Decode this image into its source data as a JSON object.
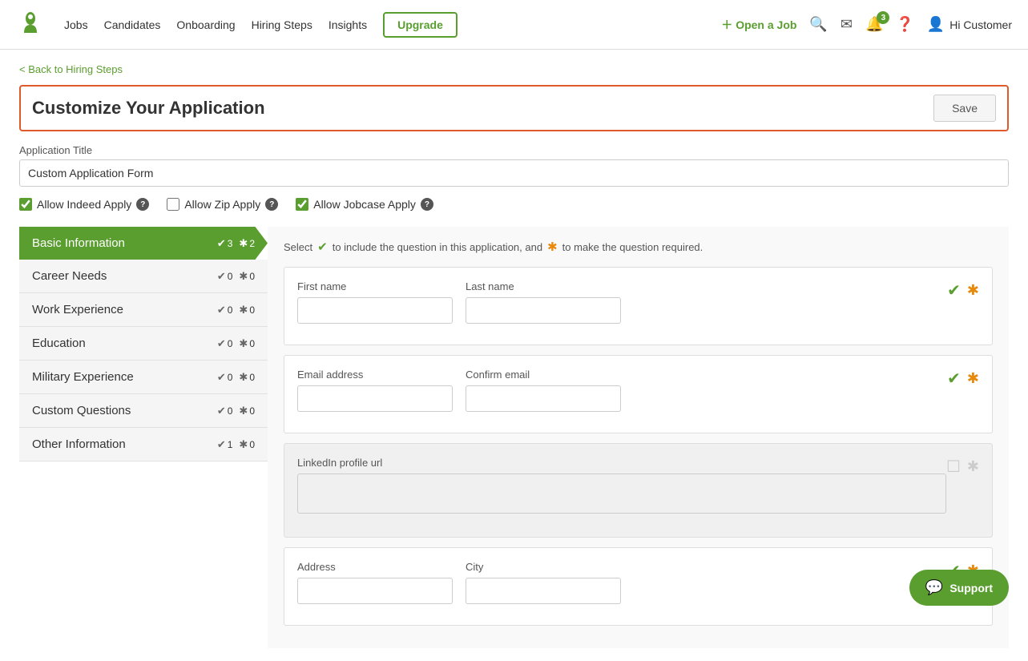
{
  "nav": {
    "logo_alt": "Jobcase logo",
    "links": [
      "Jobs",
      "Candidates",
      "Onboarding",
      "Hiring Steps",
      "Insights"
    ],
    "upgrade_label": "Upgrade",
    "open_job_label": "Open a Job",
    "notification_count": "3",
    "user_greeting": "Hi Customer"
  },
  "back_link": "< Back to Hiring Steps",
  "page_header": {
    "title": "Customize Your Application",
    "save_label": "Save"
  },
  "application_title_label": "Application Title",
  "application_title_value": "Custom Application Form",
  "apply_options": [
    {
      "id": "indeed",
      "label": "Allow Indeed Apply",
      "checked": true
    },
    {
      "id": "zip",
      "label": "Allow Zip Apply",
      "checked": false
    },
    {
      "id": "jobcase",
      "label": "Allow Jobcase Apply",
      "checked": true
    }
  ],
  "instruction": {
    "text1": "Select",
    "text2": "to include the question in this application, and",
    "text3": "to make the question required."
  },
  "sidebar": {
    "items": [
      {
        "label": "Basic Information",
        "check_count": "3",
        "star_count": "2",
        "active": true
      },
      {
        "label": "Career Needs",
        "check_count": "0",
        "star_count": "0",
        "active": false
      },
      {
        "label": "Work Experience",
        "check_count": "0",
        "star_count": "0",
        "active": false
      },
      {
        "label": "Education",
        "check_count": "0",
        "star_count": "0",
        "active": false
      },
      {
        "label": "Military Experience",
        "check_count": "0",
        "star_count": "0",
        "active": false
      },
      {
        "label": "Custom Questions",
        "check_count": "0",
        "star_count": "0",
        "active": false
      },
      {
        "label": "Other Information",
        "check_count": "1",
        "star_count": "0",
        "active": false
      }
    ]
  },
  "questions": [
    {
      "id": "name",
      "fields": [
        {
          "label": "First name",
          "value": ""
        },
        {
          "label": "Last name",
          "value": ""
        }
      ],
      "checked": true,
      "required": true,
      "inactive": false
    },
    {
      "id": "email",
      "fields": [
        {
          "label": "Email address",
          "value": ""
        },
        {
          "label": "Confirm email",
          "value": ""
        }
      ],
      "checked": true,
      "required": true,
      "inactive": false
    },
    {
      "id": "linkedin",
      "fields": [
        {
          "label": "LinkedIn profile url",
          "value": "",
          "textarea": true
        }
      ],
      "checked": false,
      "required": false,
      "inactive": true
    },
    {
      "id": "address",
      "fields": [
        {
          "label": "Address",
          "value": ""
        },
        {
          "label": "City",
          "value": ""
        }
      ],
      "checked": true,
      "required": true,
      "inactive": false
    }
  ],
  "support_label": "Support"
}
